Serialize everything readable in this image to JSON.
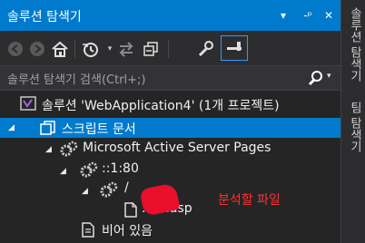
{
  "panel": {
    "title": "솔루션 탐색기",
    "title_buttons": [
      "▾",
      "-ᵖ",
      "✕"
    ]
  },
  "search": {
    "placeholder": "솔루션 탐색기 검색(Ctrl+;)"
  },
  "side_tabs": {
    "solution_explorer": "솔루션 탐색기",
    "team_explorer": "팀 탐색기"
  },
  "tree": {
    "solution": "솔루션 'WebApplication4' (1개 프로젝트)",
    "script_docs": "스크립트 문서",
    "asp_pages": "Microsoft Active Server Pages",
    "host": "::1:80",
    "root": "/",
    "file": "...er.asp",
    "empty": "비어 있음"
  },
  "annotation": "분석할 파일",
  "colors": {
    "accent": "#007acc",
    "annotation": "#ff3030",
    "redaction": "#e8102c"
  },
  "icons": [
    "back-icon",
    "forward-icon",
    "home-icon",
    "history-icon",
    "sync-icon",
    "collapse-all-icon",
    "properties-icon",
    "preview-pin-icon",
    "search-icon"
  ]
}
